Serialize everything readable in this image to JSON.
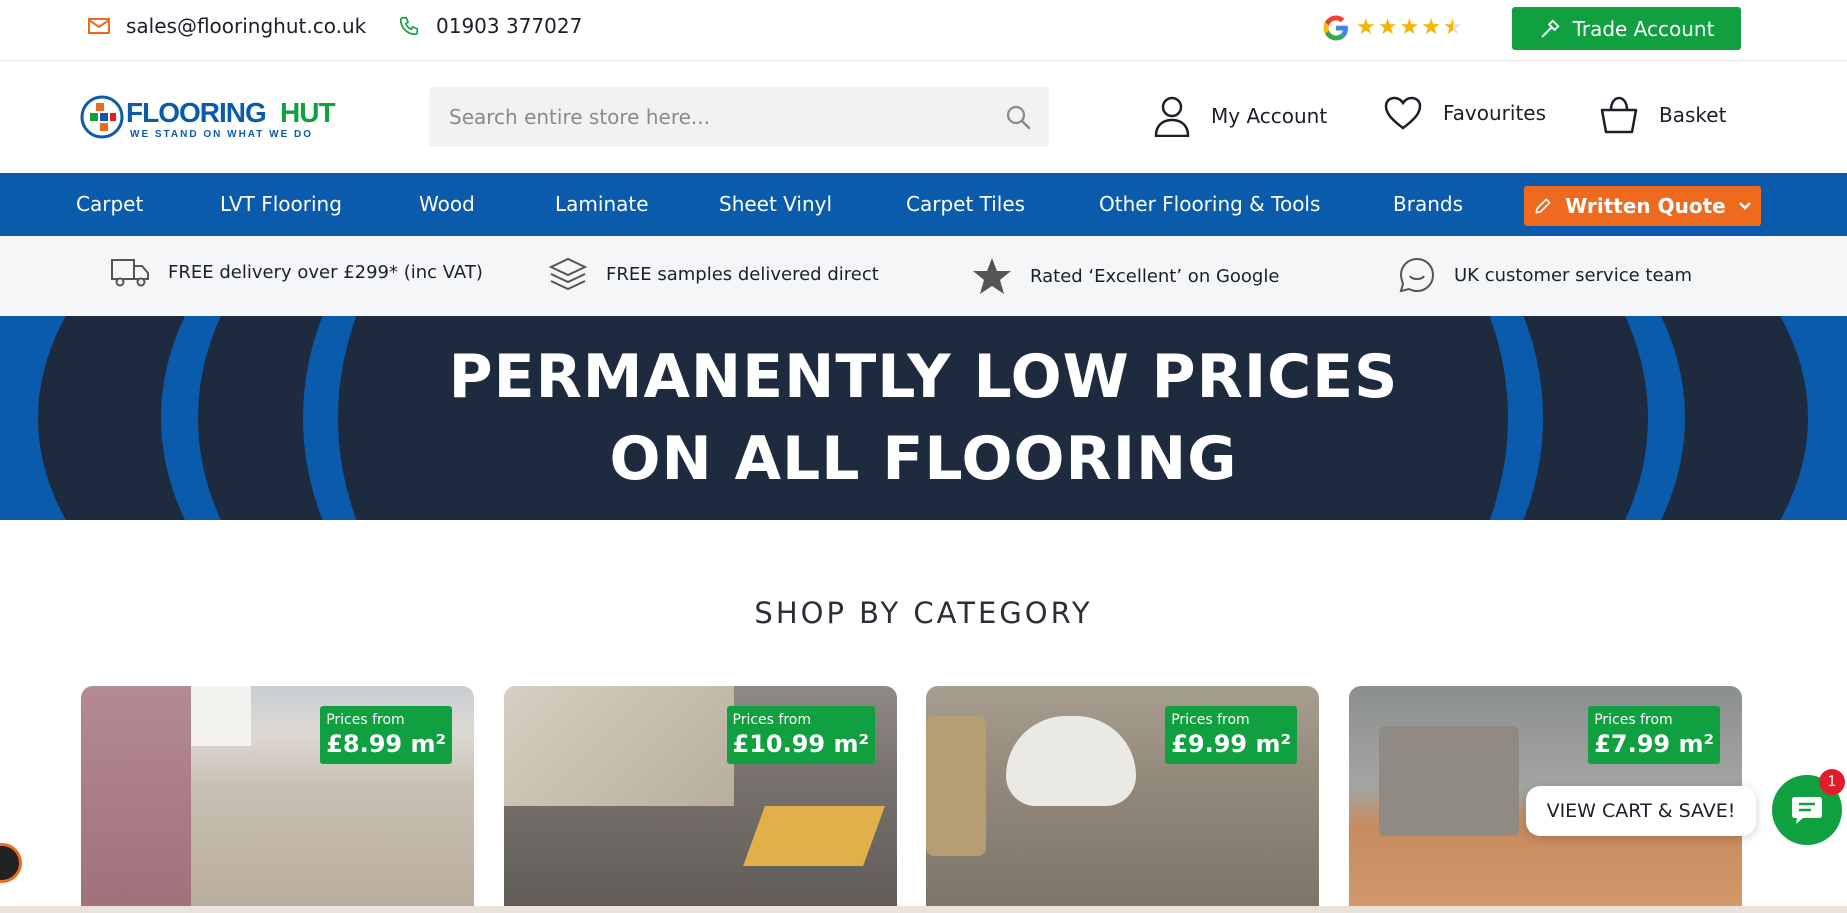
{
  "topbar": {
    "email": "sales@flooringhut.co.uk",
    "phone": "01903 377027",
    "trade_account_label": "Trade Account",
    "rating_stars": 4.5
  },
  "header": {
    "logo_text_a": "FLOORING",
    "logo_text_b": "HUT",
    "logo_tagline": "WE STAND ON WHAT WE DO",
    "search_placeholder": "Search entire store here...",
    "my_account": "My Account",
    "favourites": "Favourites",
    "basket": "Basket"
  },
  "nav": {
    "items": [
      "Carpet",
      "LVT Flooring",
      "Wood",
      "Laminate",
      "Sheet Vinyl",
      "Carpet Tiles",
      "Other Flooring & Tools",
      "Brands"
    ],
    "quote_label": "Written Quote"
  },
  "usp": [
    {
      "icon": "delivery-truck-icon",
      "text": "FREE delivery over £299* (inc VAT)"
    },
    {
      "icon": "samples-layers-icon",
      "text": "FREE samples delivered direct"
    },
    {
      "icon": "star-icon",
      "text": "Rated ‘Excellent’ on Google"
    },
    {
      "icon": "chat-icon",
      "text": "UK customer service team"
    }
  ],
  "banner": {
    "line1": "PERMANENTLY LOW PRICES",
    "line2": "ON ALL FLOORING"
  },
  "section": {
    "title": "SHOP BY CATEGORY"
  },
  "categories": [
    {
      "price_label": "Prices from",
      "price": "£8.99 m²"
    },
    {
      "price_label": "Prices from",
      "price": "£10.99 m²"
    },
    {
      "price_label": "Prices from",
      "price": "£9.99 m²"
    },
    {
      "price_label": "Prices from",
      "price": "£7.99 m²"
    }
  ],
  "widgets": {
    "view_cart": "VIEW CART & SAVE!",
    "chat_badge": "1"
  },
  "colors": {
    "brand_blue": "#0a5bab",
    "brand_orange": "#ee6a1f",
    "brand_green": "#10a040",
    "banner_navy": "#1e2a3e"
  }
}
